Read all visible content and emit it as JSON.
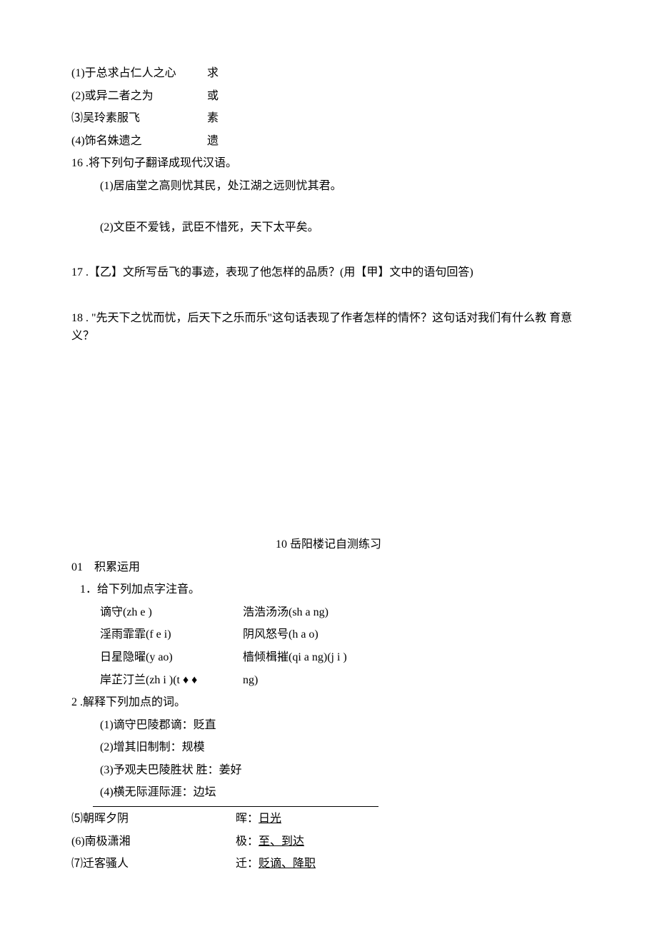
{
  "block1": {
    "items": [
      {
        "left": "(1)于总求占仁人之心",
        "right": "求"
      },
      {
        "left": "(2)或异二者之为",
        "right": "或"
      },
      {
        "left": "⑶吴玲素服飞",
        "right": "素"
      },
      {
        "left": "(4)饰名姝遗之",
        "right": "遗"
      }
    ],
    "q16": "16 .将下列句子翻译成现代汉语。",
    "q16_1": "(1)居庙堂之高则忧其民，处江湖之远则忧其君。",
    "q16_2": "(2)文臣不爱钱，武臣不惜死，天下太平矣。",
    "q17": "17 .【乙】文所写岳飞的事迹，表现了他怎样的品质？(用【甲】文中的语句回答)",
    "q18": "18 . \"先天下之忧而忧，后天下之乐而乐\"这句话表现了作者怎样的情怀？这句话对我们有什么教 育意义？"
  },
  "block2": {
    "title": "10 岳阳楼记自测练习",
    "section": "01　积累运用",
    "q1": "1．给下列加点字注音。",
    "pinyin": [
      {
        "l": "谪守(zh e )",
        "r": "浩浩汤汤(sh a ng)"
      },
      {
        "l": "淫雨霏霏(f e i)",
        "r": "阴风怒号(h a o)"
      },
      {
        "l": "日星隐曜(y ao)",
        "r": "樯倾楫摧(qi a ng)(j i )"
      },
      {
        "l": "岸芷汀兰(zh i )(t ♦ ♦",
        "r": "ng)"
      }
    ],
    "q2": "2 .解释下列加点的词。",
    "defs": [
      "(1)谪守巴陵郡谪：贬直",
      "(2)增其旧制制：规模",
      "(3)予观夫巴陵胜状 胜：姜好",
      "(4)横无际涯际涯：边坛"
    ],
    "table": [
      {
        "l": "⑸朝晖夕阴",
        "r": "晖：",
        "u": "日光"
      },
      {
        "l": "(6)南极潇湘",
        "r": "极：",
        "u": "至、到达"
      },
      {
        "l": "⑺迁客骚人",
        "r": "迁：",
        "u": "贬谪、降职"
      }
    ]
  }
}
